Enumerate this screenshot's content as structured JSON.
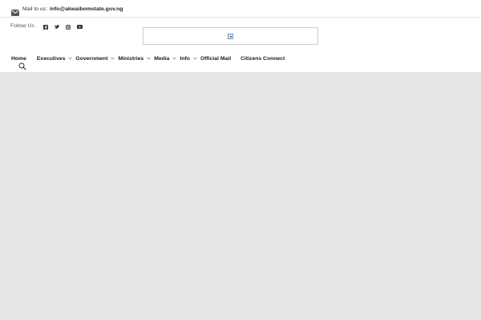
{
  "topbar": {
    "mail_label": "Mail to us:",
    "mail_address": "info@akwaibomstate.gov.ng"
  },
  "header": {
    "follow_label": "Follow Us",
    "social": [
      "facebook-icon",
      "twitter-icon",
      "instagram-icon",
      "youtube-icon"
    ]
  },
  "nav": {
    "items": [
      {
        "label": "Home",
        "dropdown": false
      },
      {
        "label": "Executives",
        "dropdown": true
      },
      {
        "label": "Government",
        "dropdown": true
      },
      {
        "label": "Ministries",
        "dropdown": true
      },
      {
        "label": "Media",
        "dropdown": true
      },
      {
        "label": "Info",
        "dropdown": true
      },
      {
        "label": "Official Mail",
        "dropdown": false
      },
      {
        "label": "Citizens Connect",
        "dropdown": false
      }
    ]
  },
  "colors": {
    "background": "#e6e6e6",
    "header": "#ffffff",
    "text": "#1a1a1a"
  }
}
